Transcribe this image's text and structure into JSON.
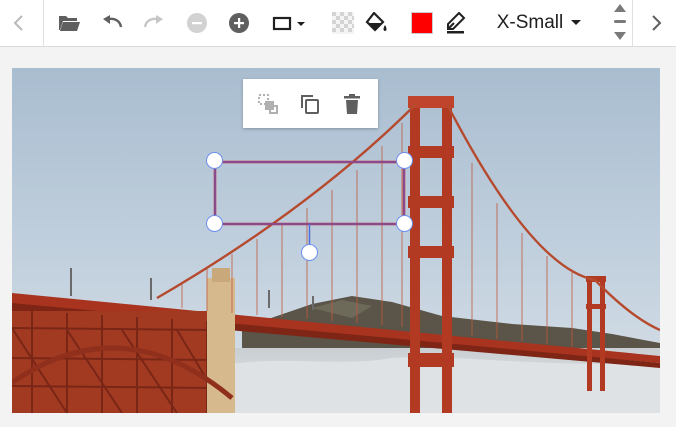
{
  "toolbar": {
    "font_size_label": "X-Small",
    "fill_color": "#ff0000",
    "icons": {
      "scroll_left": "chevron-left-icon",
      "open": "folder-open-icon",
      "undo": "undo-icon",
      "redo": "redo-icon",
      "remove": "minus-circle-icon",
      "add": "plus-circle-icon",
      "shape": "rectangle-shape-icon",
      "transparency": "checkerboard-icon",
      "fill": "paint-bucket-icon",
      "stroke": "pen-icon",
      "stepper": "up-down-stepper-icon",
      "scroll_right": "chevron-right-icon"
    }
  },
  "selection_toolbar": {
    "icons": [
      "ungroup-icon",
      "duplicate-icon",
      "delete-icon"
    ]
  },
  "canvas": {
    "image": "golden-gate-bridge-photo",
    "shape_type": "rectangle",
    "shape_stroke_color": "#c8273a"
  }
}
